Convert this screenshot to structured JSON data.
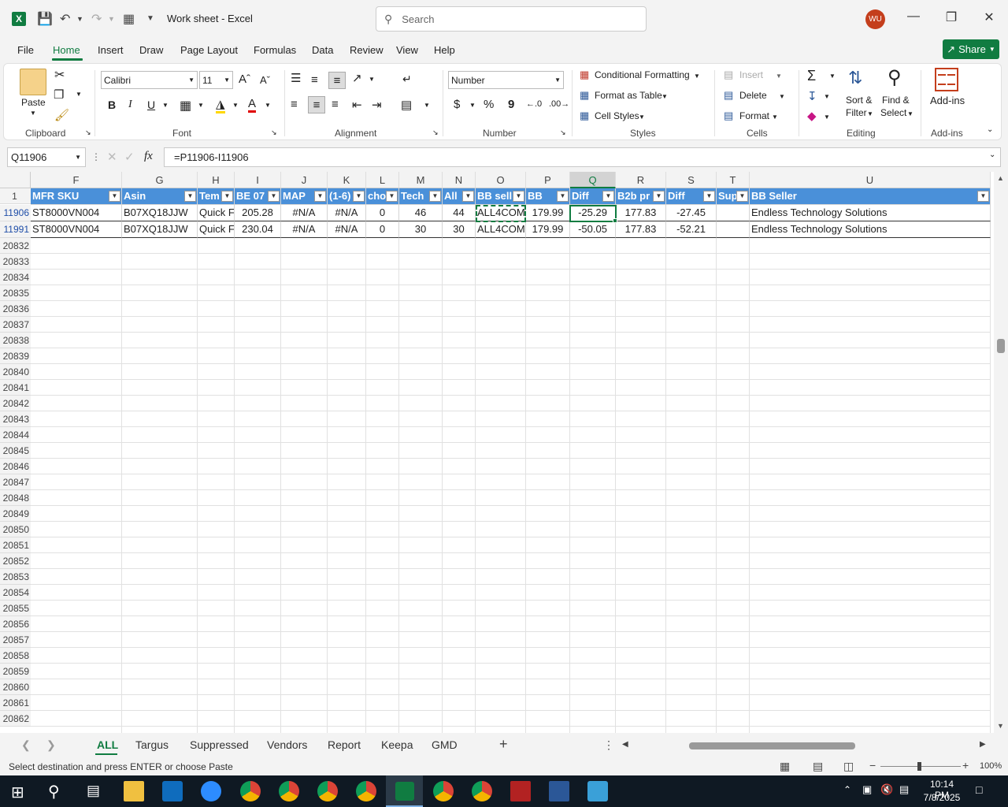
{
  "window": {
    "doc_title": "Work sheet  -  Excel",
    "search_placeholder": "Search",
    "avatar_initials": "WU"
  },
  "menu": {
    "items": [
      "File",
      "Home",
      "Insert",
      "Draw",
      "Page Layout",
      "Formulas",
      "Data",
      "Review",
      "View",
      "Help"
    ],
    "active": "Home",
    "share_label": "Share"
  },
  "ribbon": {
    "clipboard": {
      "paste": "Paste",
      "label": "Clipboard"
    },
    "font": {
      "name": "Calibri",
      "size": "11",
      "bold": "B",
      "italic": "I",
      "underline": "U",
      "label": "Font"
    },
    "alignment": {
      "label": "Alignment"
    },
    "number": {
      "format": "Number",
      "currency": "$",
      "percent": "%",
      "comma": "9",
      "label": "Number"
    },
    "styles": {
      "conditional": "Conditional Formatting",
      "format_table": "Format as Table",
      "cell_styles": "Cell Styles",
      "label": "Styles"
    },
    "cells": {
      "insert": "Insert",
      "delete": "Delete",
      "format": "Format",
      "label": "Cells"
    },
    "editing": {
      "sort_filter_1": "Sort &",
      "sort_filter_2": "Filter",
      "find_select_1": "Find &",
      "find_select_2": "Select",
      "label": "Editing"
    },
    "addins": {
      "button": "Add-ins",
      "label": "Add-ins"
    }
  },
  "formula_bar": {
    "name_box": "Q11906",
    "fx": "fx",
    "formula": "=P11906-I11906"
  },
  "columns": [
    "F",
    "G",
    "H",
    "I",
    "J",
    "K",
    "L",
    "M",
    "N",
    "O",
    "P",
    "Q",
    "R",
    "S",
    "T",
    "U"
  ],
  "header_row": {
    "row_number": "1",
    "cells": [
      "MFR SKU",
      "Asin",
      "Tem",
      "BE 07",
      "MAP",
      "(1-6)",
      "cho",
      "Tech",
      "All",
      "BB sell",
      "BB",
      "Diff",
      "B2b pr",
      "Diff",
      "Sup",
      "BB Seller"
    ]
  },
  "data_rows": [
    {
      "row_number": "11906",
      "cells": [
        "ST8000VN004",
        "B07XQ18JJW",
        "Quick F",
        "205.28",
        "#N/A",
        "#N/A",
        "0",
        "46",
        "44",
        "ALL4COM",
        "179.99",
        "-25.29",
        "177.83",
        "-27.45",
        "",
        "Endless Technology Solutions"
      ]
    },
    {
      "row_number": "11991",
      "cells": [
        "ST8000VN004",
        "B07XQ18JJW",
        "Quick F",
        "230.04",
        "#N/A",
        "#N/A",
        "0",
        "30",
        "30",
        "ALL4COM",
        "179.99",
        "-50.05",
        "177.83",
        "-52.21",
        "",
        "Endless Technology Solutions"
      ]
    }
  ],
  "empty_rows": [
    "20832",
    "20833",
    "20834",
    "20835",
    "20836",
    "20837",
    "20838",
    "20839",
    "20840",
    "20841",
    "20842",
    "20843",
    "20844",
    "20845",
    "20846",
    "20847",
    "20848",
    "20849",
    "20850",
    "20851",
    "20852",
    "20853",
    "20854",
    "20855",
    "20856",
    "20857",
    "20858",
    "20859",
    "20860",
    "20861",
    "20862"
  ],
  "sheets": [
    "ALL",
    "Targus",
    "Suppressed",
    "Vendors",
    "Report",
    "Keepa",
    "GMD"
  ],
  "active_sheet": "ALL",
  "status": {
    "message": "Select destination and press ENTER or choose Paste",
    "zoom": "100%"
  },
  "taskbar": {
    "time": "10:14 PM",
    "date": "7/8/2025"
  },
  "colors": {
    "accent": "#107c41",
    "header_fill": "#4a90d9",
    "avatar": "#c43e1c"
  }
}
